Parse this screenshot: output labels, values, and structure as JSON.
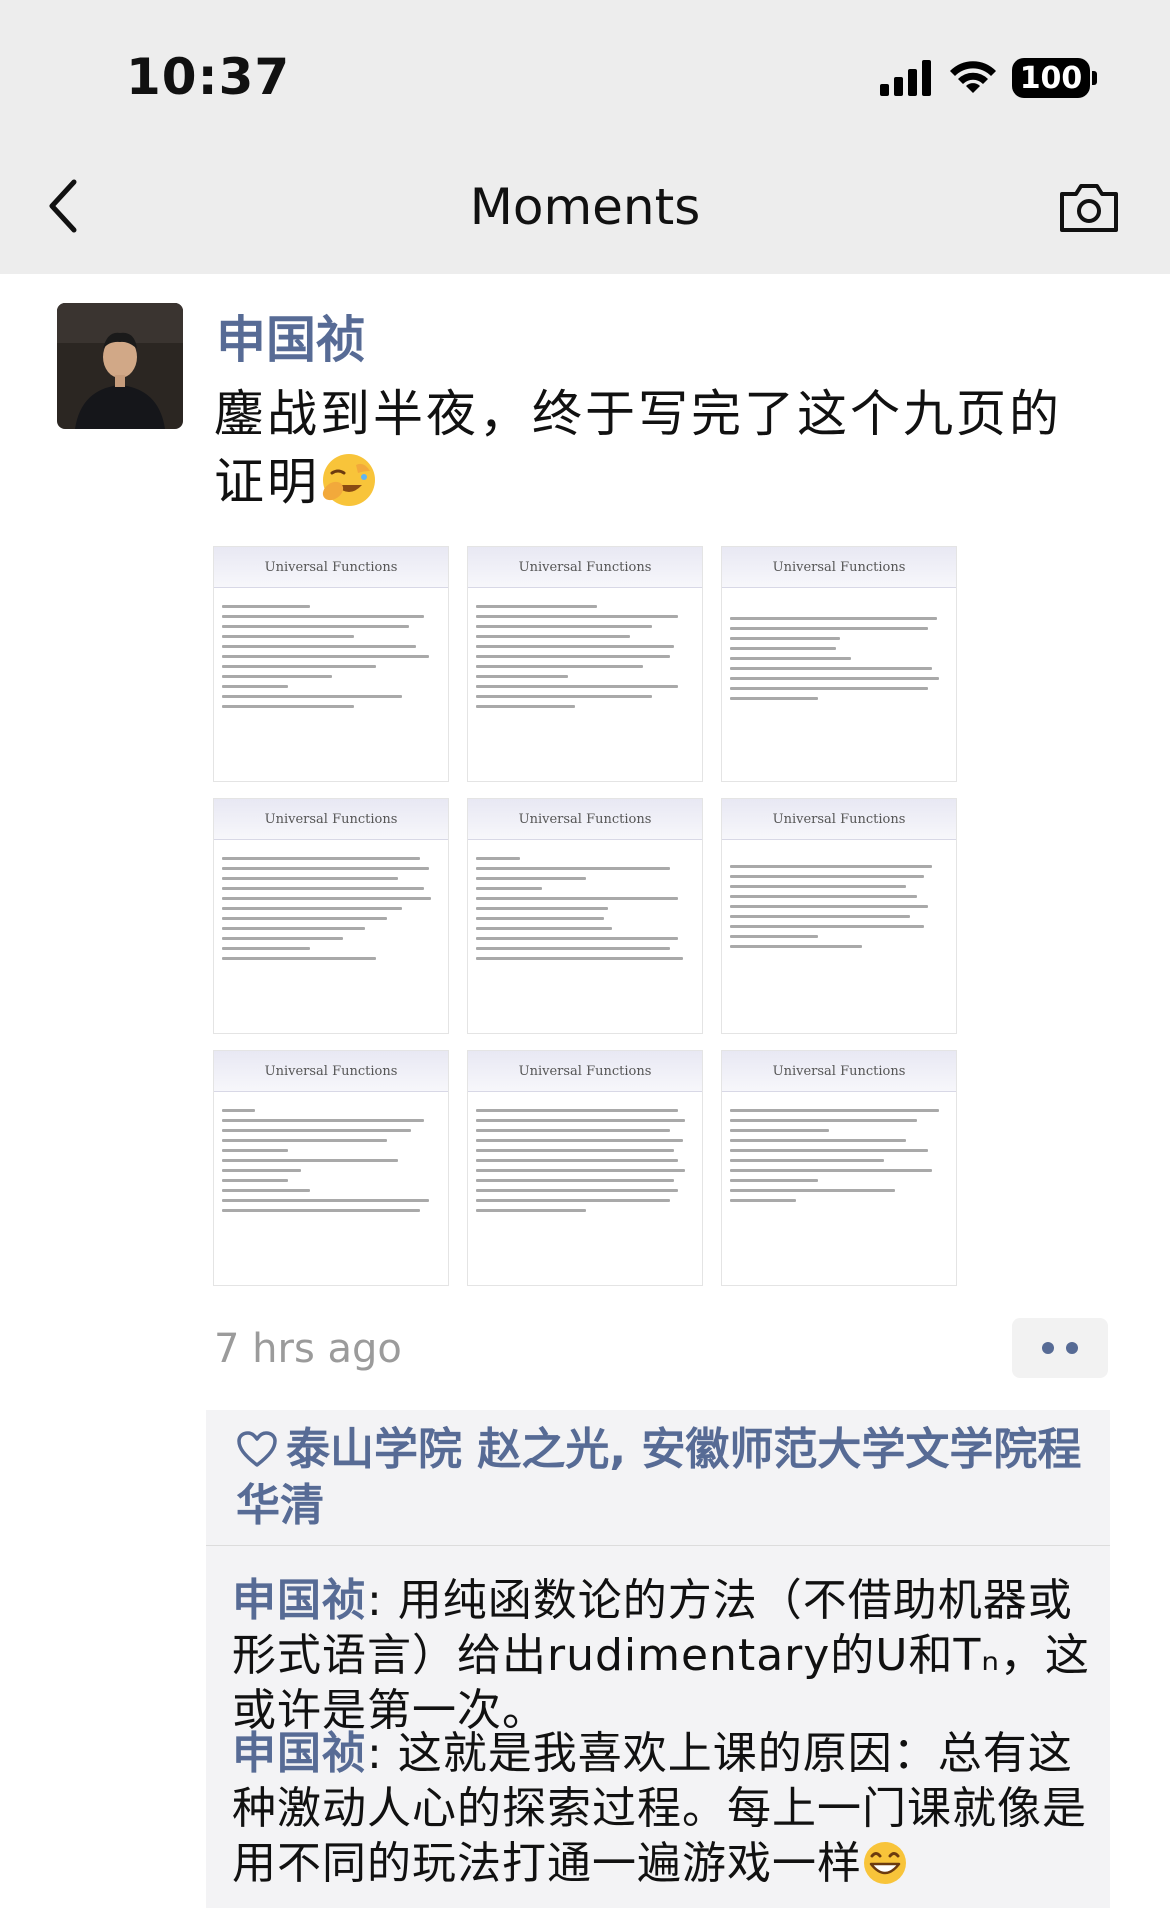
{
  "status": {
    "time": "10:37",
    "battery": "100"
  },
  "nav": {
    "title": "Moments"
  },
  "post": {
    "author": "申国祯",
    "text": "鏖战到半夜，终于写完了这个九页的证明",
    "time": "7 hrs ago",
    "images": [
      {
        "title": "Universal Functions"
      },
      {
        "title": "Universal Functions"
      },
      {
        "title": "Universal Functions"
      },
      {
        "title": "Universal Functions"
      },
      {
        "title": "Universal Functions"
      },
      {
        "title": "Universal Functions"
      },
      {
        "title": "Universal Functions"
      },
      {
        "title": "Universal Functions"
      },
      {
        "title": "Universal Functions"
      }
    ]
  },
  "likes": {
    "names": "泰山学院 赵之光, 安徽师范大学文学院程华清"
  },
  "comments": [
    {
      "author": "申国祯",
      "text": ": 用纯函数论的方法（不借助机器或形式语言）给出rudimentary的U和Tₙ，这或许是第一次。"
    },
    {
      "author": "申国祯",
      "text": ": 这就是我喜欢上课的原因：总有这种激动人心的探索过程。每上一门课就像是用不同的玩法打通一遍游戏一样"
    }
  ],
  "icons": {
    "back": "chevron-left-icon",
    "camera": "camera-icon",
    "like": "heart-outline-icon",
    "more": "more-dots-icon",
    "emoji_post": "facepalm-laugh-emoji",
    "emoji_comment": "grinning-emoji"
  },
  "colors": {
    "link": "#576b95",
    "topbar": "#ededed",
    "timestamp": "#9b9b9b"
  }
}
